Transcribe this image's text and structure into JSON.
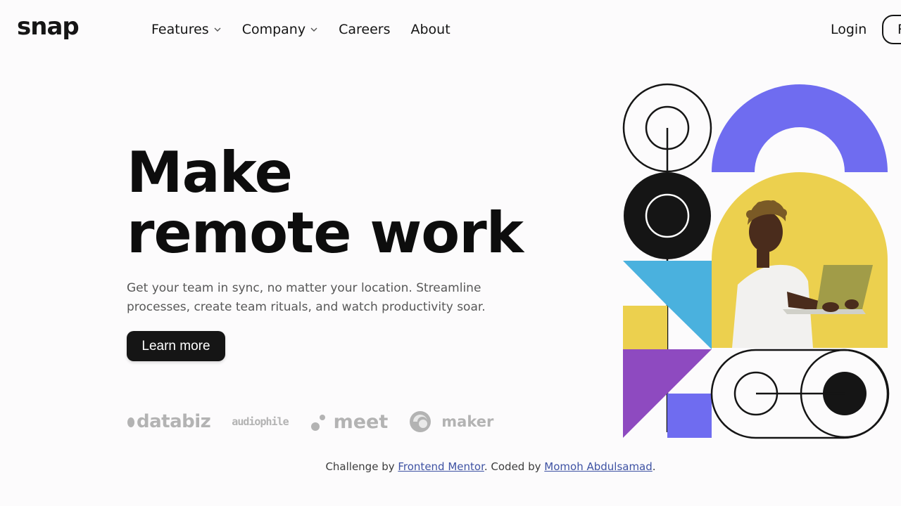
{
  "header": {
    "logo": "snap",
    "nav": [
      {
        "label": "Features",
        "has_dropdown": true
      },
      {
        "label": "Company",
        "has_dropdown": true
      },
      {
        "label": "Careers",
        "has_dropdown": false
      },
      {
        "label": "About",
        "has_dropdown": false
      }
    ],
    "login_label": "Login",
    "register_label": "Register"
  },
  "hero": {
    "title_line1": "Make",
    "title_line2": "remote work",
    "description": "Get your team in sync, no matter your location. Streamline processes, create team rituals, and watch productivity soar.",
    "cta_label": "Learn more"
  },
  "clients": [
    {
      "name": "databiz"
    },
    {
      "name": "audiophile"
    },
    {
      "name": "meet"
    },
    {
      "name": "maker"
    }
  ],
  "footer": {
    "prefix": "Challenge by ",
    "link1": "Frontend Mentor",
    "middle": ". Coded by ",
    "link2": "Momoh Abdulsamad",
    "suffix": "."
  },
  "colors": {
    "background": "#fcfbfc",
    "dark": "#151515",
    "purple": "#6f6cf0",
    "yellow": "#ecd04e",
    "blue": "#4ab1de",
    "violet": "#8e4ac0",
    "link": "#3e52a3"
  },
  "icons": {
    "dropdown": "chevron-down-icon"
  }
}
